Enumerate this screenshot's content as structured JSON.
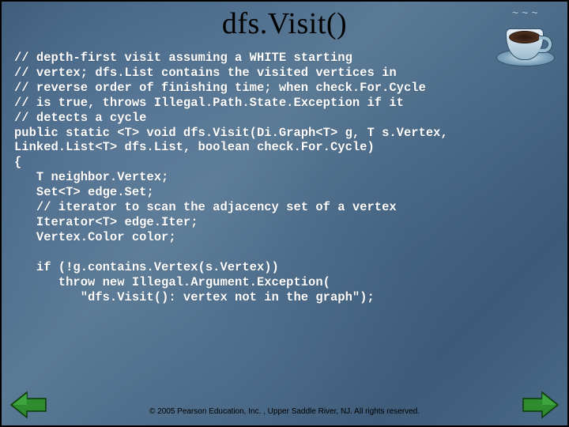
{
  "title": "dfs.Visit()",
  "code": "// depth-first visit assuming a WHITE starting\n// vertex; dfs.List contains the visited vertices in\n// reverse order of finishing time; when check.For.Cycle\n// is true, throws Illegal.Path.State.Exception if it\n// detects a cycle\npublic static <T> void dfs.Visit(Di.Graph<T> g, T s.Vertex,\nLinked.List<T> dfs.List, boolean check.For.Cycle)\n{\n   T neighbor.Vertex;\n   Set<T> edge.Set;\n   // iterator to scan the adjacency set of a vertex\n   Iterator<T> edge.Iter;\n   Vertex.Color color;\n\n   if (!g.contains.Vertex(s.Vertex))\n      throw new Illegal.Argument.Exception(\n         \"dfs.Visit(): vertex not in the graph\");",
  "footer": "© 2005 Pearson Education, Inc. , Upper Saddle River, NJ.  All rights reserved.",
  "icons": {
    "coffee": "coffee-cup-icon",
    "prev": "prev-arrow-icon",
    "next": "next-arrow-icon"
  },
  "colors": {
    "arrow_fill": "#2e8b2e",
    "arrow_stroke": "#0a3a0a"
  }
}
